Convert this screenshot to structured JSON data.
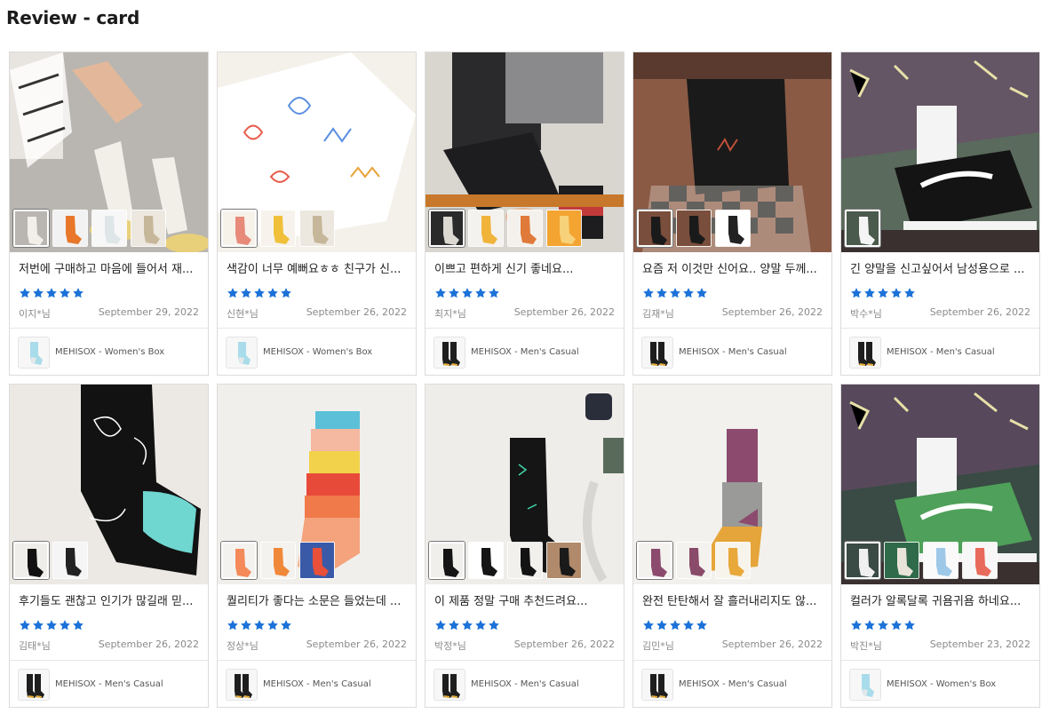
{
  "page": {
    "title": "Review - card"
  },
  "reviews": [
    {
      "text": "저번에 구매하고 마음에 들어서 재...",
      "rating": 5,
      "author": "이지*님",
      "date": "September 29, 2022",
      "product": "MEHISOX - Women's Box",
      "product_icon": "light-blue-sock",
      "photo": "skater-white-socks",
      "thumbs": [
        "skater-white-socks",
        "striped-orange-socks",
        "white-socks-pair",
        "pattern-socks"
      ]
    },
    {
      "text": "색감이 너무 예뻐요ㅎㅎ 친구가 신...",
      "rating": 5,
      "author": "신현*님",
      "date": "September 26, 2022",
      "product": "MEHISOX - Women's Box",
      "product_icon": "light-blue-sock",
      "photo": "white-doodle-socks",
      "thumbs": [
        "doodle-socks-flat",
        "yellow-character-sock",
        "pattern-socks"
      ]
    },
    {
      "text": "이쁘고 편하게 신기 좋네요...",
      "rating": 5,
      "author": "최지*님",
      "date": "September 26, 2022",
      "product": "MEHISOX - Men's Casual",
      "product_icon": "black-yellow-sock",
      "photo": "seated-man-socks",
      "thumbs": [
        "seated-man-socks",
        "yellow-orange-sock",
        "stripe-sock",
        "orange-character-socks"
      ]
    },
    {
      "text": "요즘 저 이것만 신어요.. 양말 두께...",
      "rating": 5,
      "author": "김재*님",
      "date": "September 26, 2022",
      "product": "MEHISOX - Men's Casual",
      "product_icon": "black-yellow-sock",
      "photo": "checker-shoes-black-sock",
      "thumbs": [
        "checker-shoes-black-sock",
        "checker-shoes-black-sock",
        "black-socks-box"
      ]
    },
    {
      "text": "긴 양말을 신고싶어서 남성용으로 ...",
      "rating": 5,
      "author": "박수*님",
      "date": "September 26, 2022",
      "product": "MEHISOX - Men's Casual",
      "product_icon": "black-yellow-sock",
      "photo": "sneaker-white-sock",
      "thumbs": [
        "sneaker-white-sock"
      ]
    },
    {
      "text": "후기들도 괜찮고 인기가 많길래 믿...",
      "rating": 5,
      "author": "김태*님",
      "date": "September 26, 2022",
      "product": "MEHISOX - Men's Casual",
      "product_icon": "black-yellow-sock",
      "photo": "black-line-sock",
      "thumbs": [
        "black-line-sock",
        "dotted-shoes-sock"
      ]
    },
    {
      "text": "퀄리티가 좋다는 소문은 들었는데 ...",
      "rating": 5,
      "author": "정상*님",
      "date": "September 26, 2022",
      "product": "MEHISOX - Men's Casual",
      "product_icon": "black-yellow-sock",
      "photo": "rainbow-stripe-sock",
      "thumbs": [
        "rainbow-stripe-sock",
        "orange-blue-sock",
        "colorful-shoes"
      ]
    },
    {
      "text": "이 제품 정말 구매 추천드려요...",
      "rating": 5,
      "author": "박정*님",
      "date": "September 26, 2022",
      "product": "MEHISOX - Men's Casual",
      "product_icon": "black-yellow-sock",
      "photo": "black-star-sock",
      "thumbs": [
        "black-socks-flat",
        "black-socks-pair",
        "black-star-sock",
        "worn-sock"
      ]
    },
    {
      "text": "완전 탄탄해서 잘 흘러내리지도 않...",
      "rating": 5,
      "author": "김민*님",
      "date": "September 26, 2022",
      "product": "MEHISOX - Men's Casual",
      "product_icon": "black-yellow-sock",
      "photo": "purple-grey-sock",
      "thumbs": [
        "purple-grey-sock",
        "purple-sock-folded",
        "yellow-sock-folded"
      ]
    },
    {
      "text": "컬러가 알록달록 귀욤귀욤 하네요...",
      "rating": 5,
      "author": "박진*님",
      "date": "September 23, 2022",
      "product": "MEHISOX - Women's Box",
      "product_icon": "light-blue-sock",
      "photo": "green-stripe-sneaker",
      "thumbs": [
        "green-stripe-sneaker",
        "green-print-sock",
        "white-print-sock",
        "colorful-print-sock"
      ]
    }
  ],
  "colors": {
    "star": "#1c72d8",
    "border": "#dcdcdc",
    "meta": "#8a8a8a"
  }
}
